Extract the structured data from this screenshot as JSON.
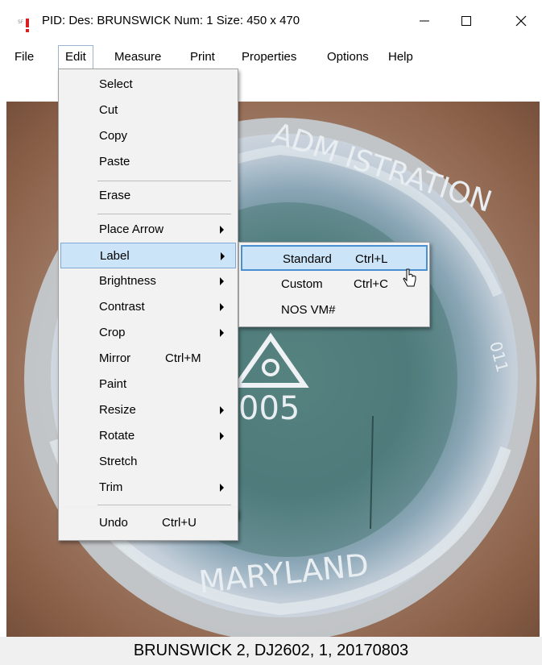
{
  "window": {
    "title": "PID:  Des: BRUNSWICK  Num: 1  Size: 450 x 470"
  },
  "menubar": {
    "items": [
      "File",
      "Edit",
      "Measure",
      "Print",
      "Properties",
      "Options",
      "Help"
    ]
  },
  "edit_menu": {
    "select": "Select",
    "cut": "Cut",
    "copy": "Copy",
    "paste": "Paste",
    "erase": "Erase",
    "place_arrow": "Place Arrow",
    "label": "Label",
    "brightness": "Brightness",
    "contrast": "Contrast",
    "crop": "Crop",
    "mirror": "Mirror",
    "mirror_shortcut": "Ctrl+M",
    "paint": "Paint",
    "resize": "Resize",
    "rotate": "Rotate",
    "stretch": "Stretch",
    "trim": "Trim",
    "undo": "Undo",
    "undo_shortcut": "Ctrl+U"
  },
  "label_submenu": {
    "standard": "Standard",
    "standard_shortcut": "Ctrl+L",
    "custom": "Custom",
    "custom_shortcut": "Ctrl+C",
    "nos": "NOS VM#"
  },
  "photo": {
    "stamp_text_top": "ADM ISTRATION",
    "stamp_number": "005",
    "stamp_text_bottom": "MARYLAND",
    "stamp_text_right": "011"
  },
  "status": {
    "text": "BRUNSWICK 2, DJ2602, 1, 20170803"
  },
  "colors": {
    "menu_highlight": "#cce4f7",
    "menu_border": "#7fa8d6",
    "menu_bg": "#f2f2f2"
  }
}
